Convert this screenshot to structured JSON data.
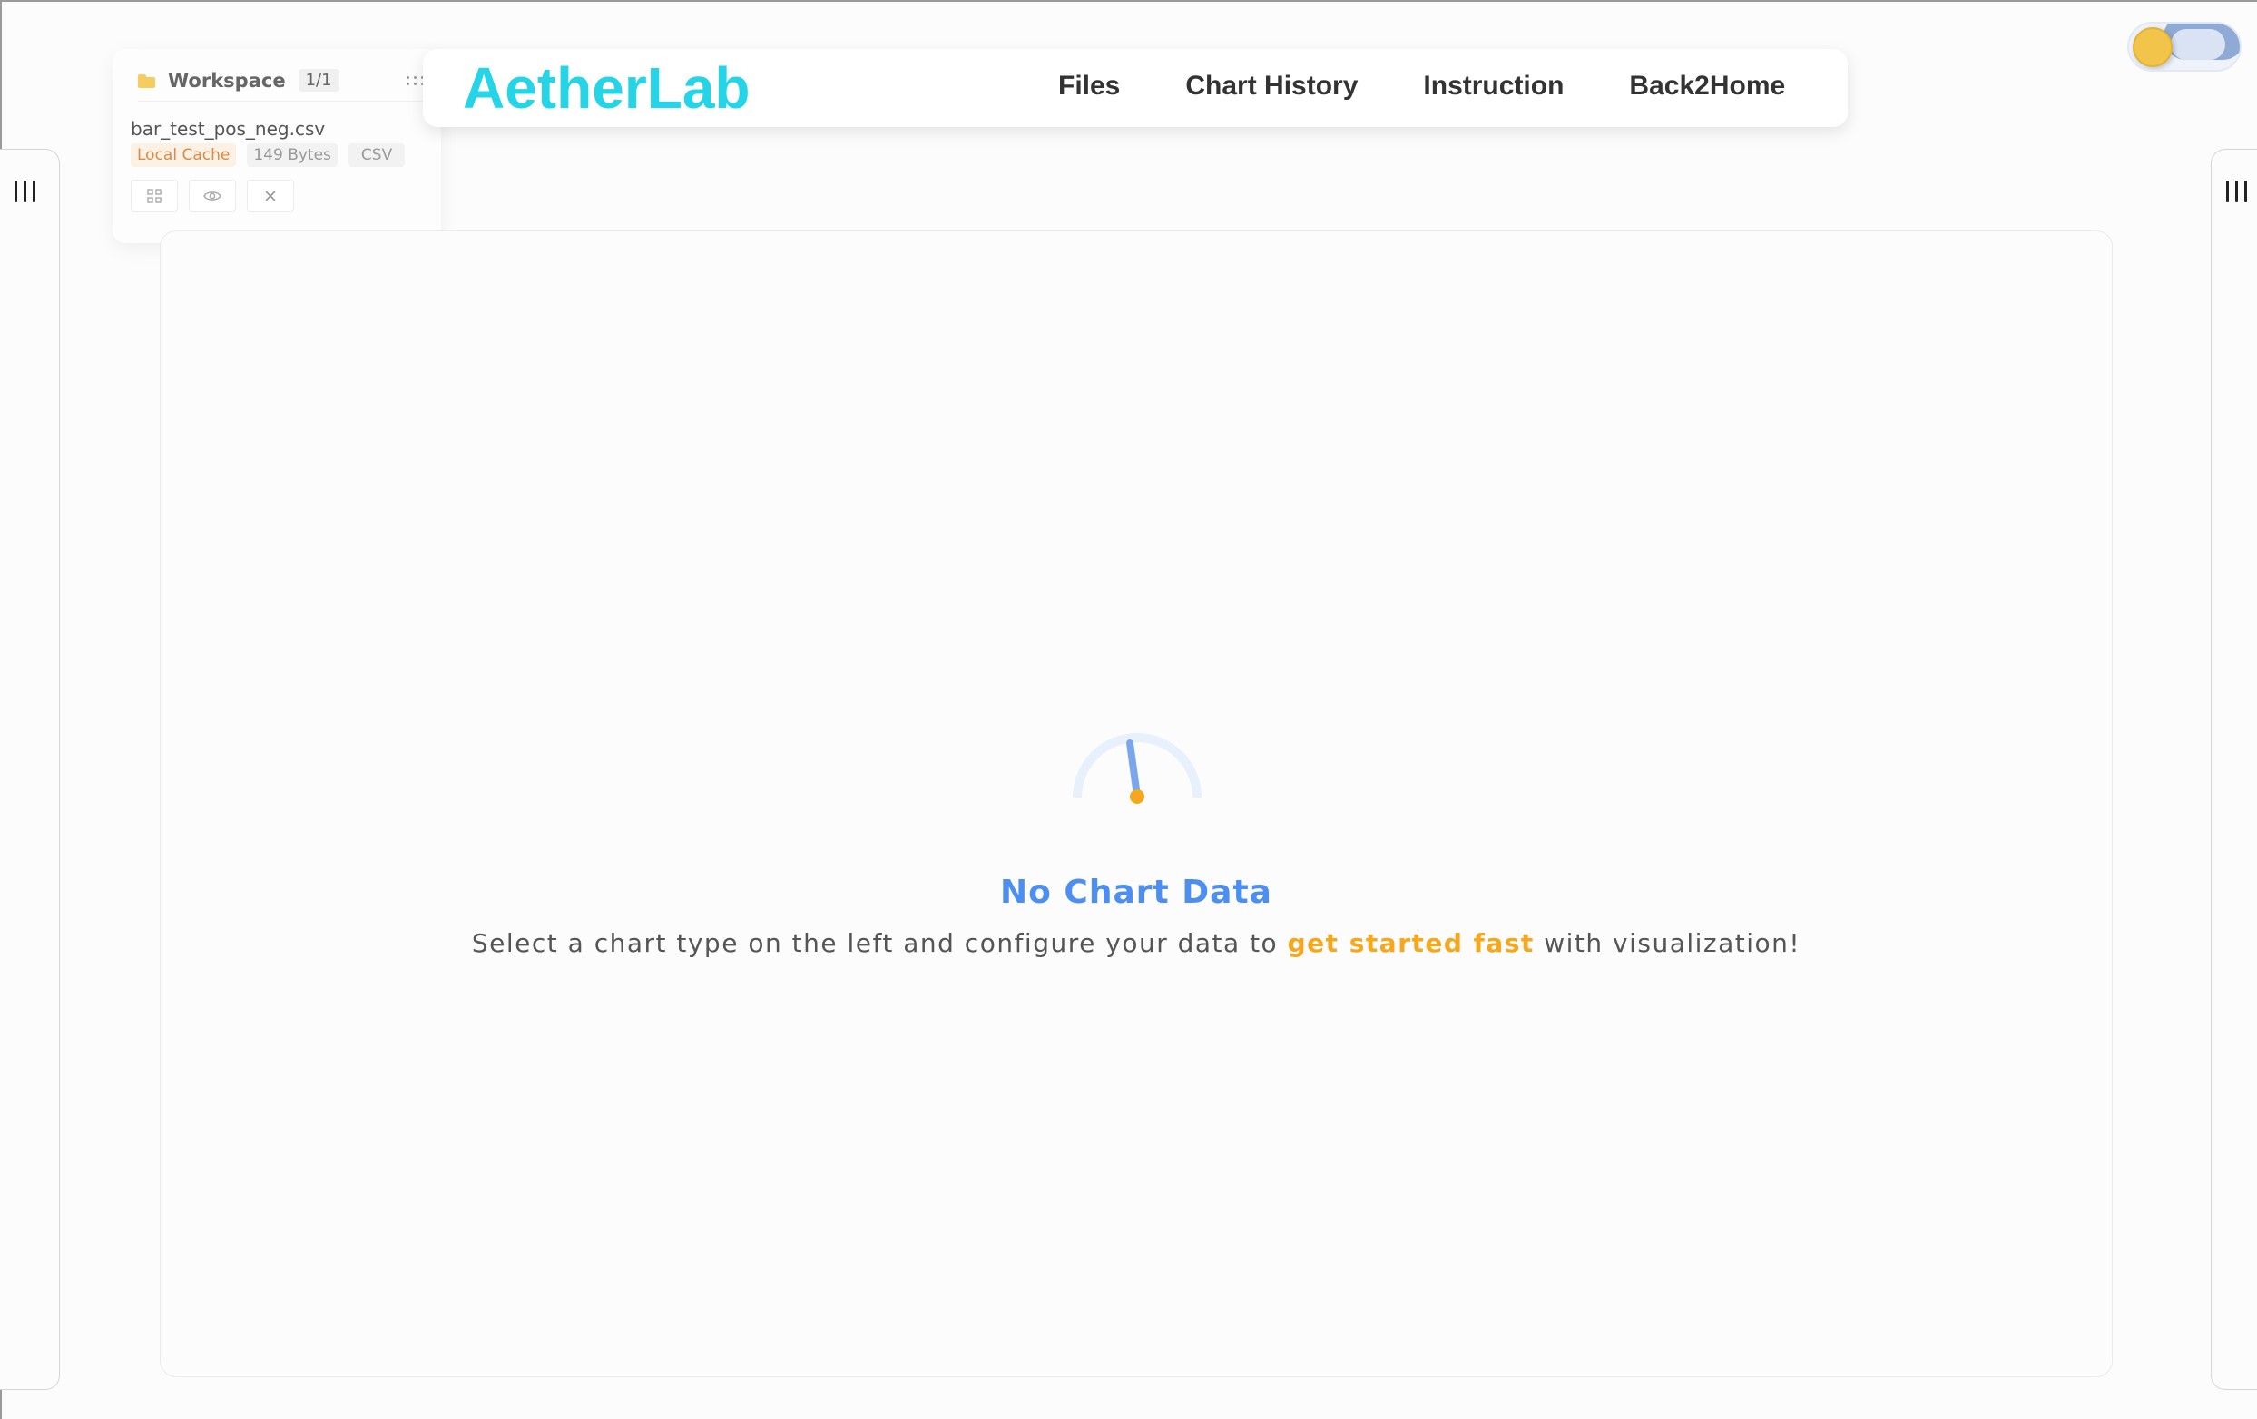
{
  "workspace": {
    "title": "Workspace",
    "count": "1/1",
    "file": {
      "name": "bar_test_pos_neg.csv",
      "tags": [
        "Local Cache",
        "149 Bytes",
        "CSV"
      ]
    },
    "actions": [
      "grid-icon",
      "eye-icon",
      "close-icon"
    ]
  },
  "navbar": {
    "brand": "AetherLab",
    "links": [
      "Files",
      "Chart History",
      "Instruction",
      "Back2Home"
    ]
  },
  "theme_toggle": {
    "state": "light"
  },
  "empty_state": {
    "title": "No Chart Data",
    "desc_before": "Select a chart type on the left and configure your data to ",
    "desc_highlight": "get started fast",
    "desc_after": " with visualization!"
  },
  "colors": {
    "brand": "#26d4e8",
    "accent_blue": "#4d8ff0",
    "accent_orange": "#f5a81e",
    "folder": "#f5cc5d"
  }
}
